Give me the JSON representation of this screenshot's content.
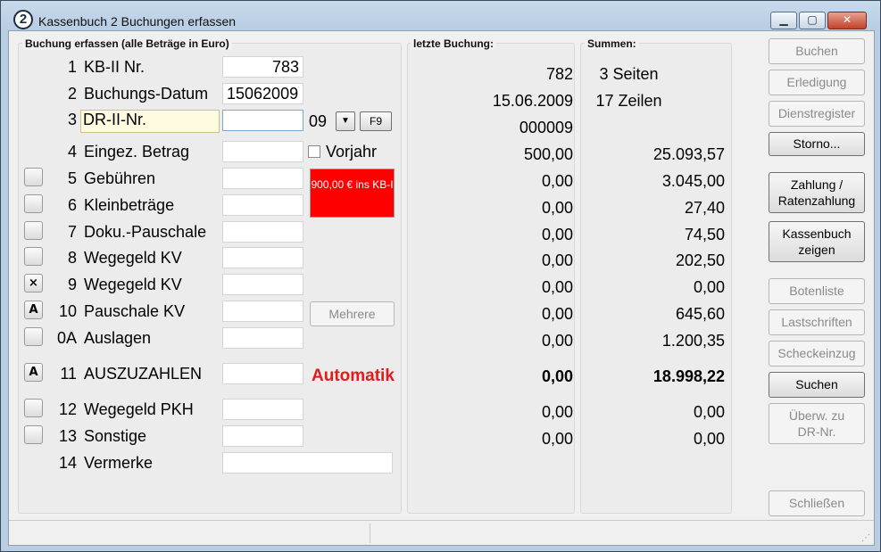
{
  "window": {
    "title": "Kassenbuch 2 Buchungen erfassen",
    "icon_text": "2",
    "minimize_glyph": "▁",
    "maximize_glyph": "▢",
    "close_glyph": "✕"
  },
  "panels": {
    "input_title": "Buchung erfassen (alle Beträge in Euro)",
    "last_title": "letzte Buchung:",
    "sums_title": "Summen:"
  },
  "rows": [
    {
      "num": "1",
      "label": "KB-II Nr.",
      "value": "783"
    },
    {
      "num": "2",
      "label": "Buchungs-Datum",
      "value": "15062009"
    },
    {
      "num": "3",
      "label": "DR-II-Nr.",
      "value": "",
      "combo": "09",
      "f9": "F9"
    },
    {
      "num": "4",
      "label": "Eingez. Betrag",
      "value": ""
    },
    {
      "num": "5",
      "label": "Gebühren",
      "value": "",
      "check": ""
    },
    {
      "num": "6",
      "label": "Kleinbeträge",
      "value": "",
      "check": ""
    },
    {
      "num": "7",
      "label": "Doku.-Pauschale",
      "value": "",
      "check": ""
    },
    {
      "num": "8",
      "label": "Wegegeld KV",
      "value": "",
      "check": ""
    },
    {
      "num": "9",
      "label": "Wegegeld KV",
      "value": "",
      "check": "×"
    },
    {
      "num": "10",
      "label": "Pauschale KV",
      "value": "",
      "check": "A"
    },
    {
      "num": "0A",
      "label": "Auslagen",
      "value": "",
      "check": ""
    },
    {
      "num": "11",
      "label": "AUSZUZAHLEN",
      "value": "",
      "check": "A"
    },
    {
      "num": "12",
      "label": "Wegegeld PKH",
      "value": "",
      "check": ""
    },
    {
      "num": "13",
      "label": "Sonstige",
      "value": "",
      "check": ""
    },
    {
      "num": "14",
      "label": "Vermerke",
      "value": ""
    }
  ],
  "vorjahr_label": "Vorjahr",
  "red_notice": "900,00 € ins KB-I",
  "mehrere_label": "Mehrere",
  "automatik_label": "Automatik",
  "last_booking": [
    "782",
    "15.06.2009",
    "000009",
    "500,00",
    "0,00",
    "0,00",
    "0,00",
    "0,00",
    "0,00",
    "0,00",
    "0,00",
    "0,00",
    "0,00",
    "0,00"
  ],
  "sums": [
    "3 Seiten",
    "17 Zeilen",
    "25.093,57",
    "3.045,00",
    "27,40",
    "74,50",
    "202,50",
    "0,00",
    "645,60",
    "1.200,35",
    "18.998,22",
    "0,00",
    "0,00"
  ],
  "buttons": {
    "buchen": "Buchen",
    "erledigung": "Erledigung",
    "dienstregister": "Dienstregister",
    "storno": "Storno...",
    "zahlung_1": "Zahlung /",
    "zahlung_2": "Ratenzahlung",
    "kassenbuch_1": "Kassenbuch",
    "kassenbuch_2": "zeigen",
    "botenliste": "Botenliste",
    "lastschriften": "Lastschriften",
    "scheckeinzug": "Scheckeinzug",
    "suchen": "Suchen",
    "ueberw_1": "Überw. zu",
    "ueberw_2": "DR-Nr.",
    "schliessen": "Schließen"
  }
}
